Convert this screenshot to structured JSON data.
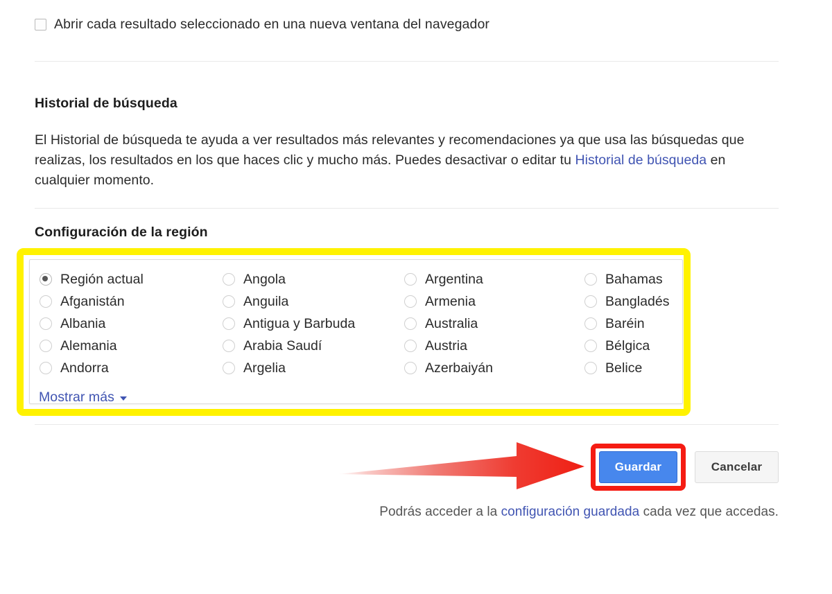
{
  "open_results": {
    "checkbox_label": "Abrir cada resultado seleccionado en una nueva ventana del navegador",
    "checked": false
  },
  "history": {
    "title": "Historial de búsqueda",
    "body_part1": "El Historial de búsqueda te ayuda a ver resultados más relevantes y recomendaciones ya que usa las búsquedas que realizas, los resultados en los que haces clic y mucho más. Puedes desactivar o editar tu ",
    "body_link": "Historial de búsqueda",
    "body_part2": " en cualquier momento."
  },
  "region": {
    "title": "Configuración de la región",
    "selected": "Región actual",
    "columns": [
      [
        "Región actual",
        "Afganistán",
        "Albania",
        "Alemania",
        "Andorra"
      ],
      [
        "Angola",
        "Anguila",
        "Antigua y Barbuda",
        "Arabia Saudí",
        "Argelia"
      ],
      [
        "Argentina",
        "Armenia",
        "Australia",
        "Austria",
        "Azerbaiyán"
      ],
      [
        "Bahamas",
        "Bangladés",
        "Baréin",
        "Bélgica",
        "Belice"
      ]
    ],
    "show_more_label": "Mostrar más"
  },
  "actions": {
    "save_label": "Guardar",
    "cancel_label": "Cancelar"
  },
  "footer": {
    "part1": "Podrás acceder a la ",
    "link": "configuración guardada",
    "part2": " cada vez que accedas."
  },
  "annotations": {
    "highlight_color": "#fff200",
    "callout_color": "#f51c13",
    "arrow_icon": "right-arrow-icon"
  },
  "colors": {
    "link": "#4054b2",
    "save_button": "#4787ed",
    "divider": "#e9e9e9"
  }
}
